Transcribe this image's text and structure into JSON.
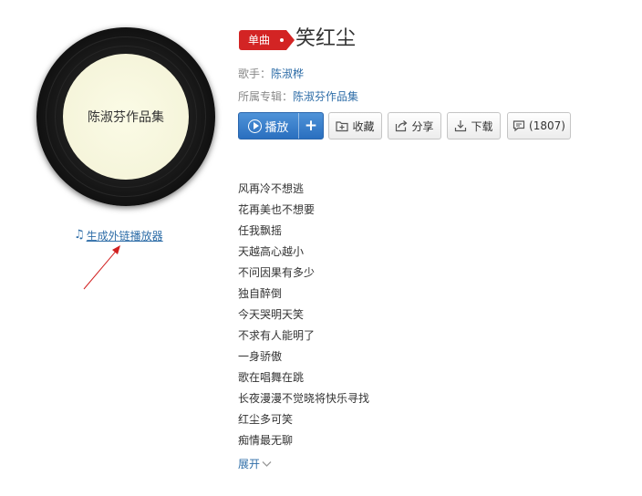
{
  "album_cover": {
    "label": "陈淑芬作品集"
  },
  "external_player": {
    "label": "生成外链播放器"
  },
  "song": {
    "badge": "单曲",
    "title": "笑红尘",
    "singer_label": "歌手：",
    "singer": "陈淑桦",
    "album_label": "所属专辑：",
    "album": "陈淑芬作品集"
  },
  "actions": {
    "play": "播放",
    "add": "+",
    "collect": "收藏",
    "share": "分享",
    "download": "下载",
    "comments": "(1807)"
  },
  "lyrics": [
    "风再冷不想逃",
    "花再美也不想要",
    "任我飘摇",
    "天越高心越小",
    "不问因果有多少",
    "独自醉倒",
    "今天哭明天笑",
    "不求有人能明了",
    "一身骄傲",
    "歌在唱舞在跳",
    "长夜漫漫不觉晓将快乐寻找",
    "红尘多可笑",
    "痴情最无聊"
  ],
  "expand": {
    "label": "展开"
  },
  "colors": {
    "accent_blue": "#2f6ea8",
    "badge_red": "#d32424",
    "play_blue": "#3a80cc"
  }
}
